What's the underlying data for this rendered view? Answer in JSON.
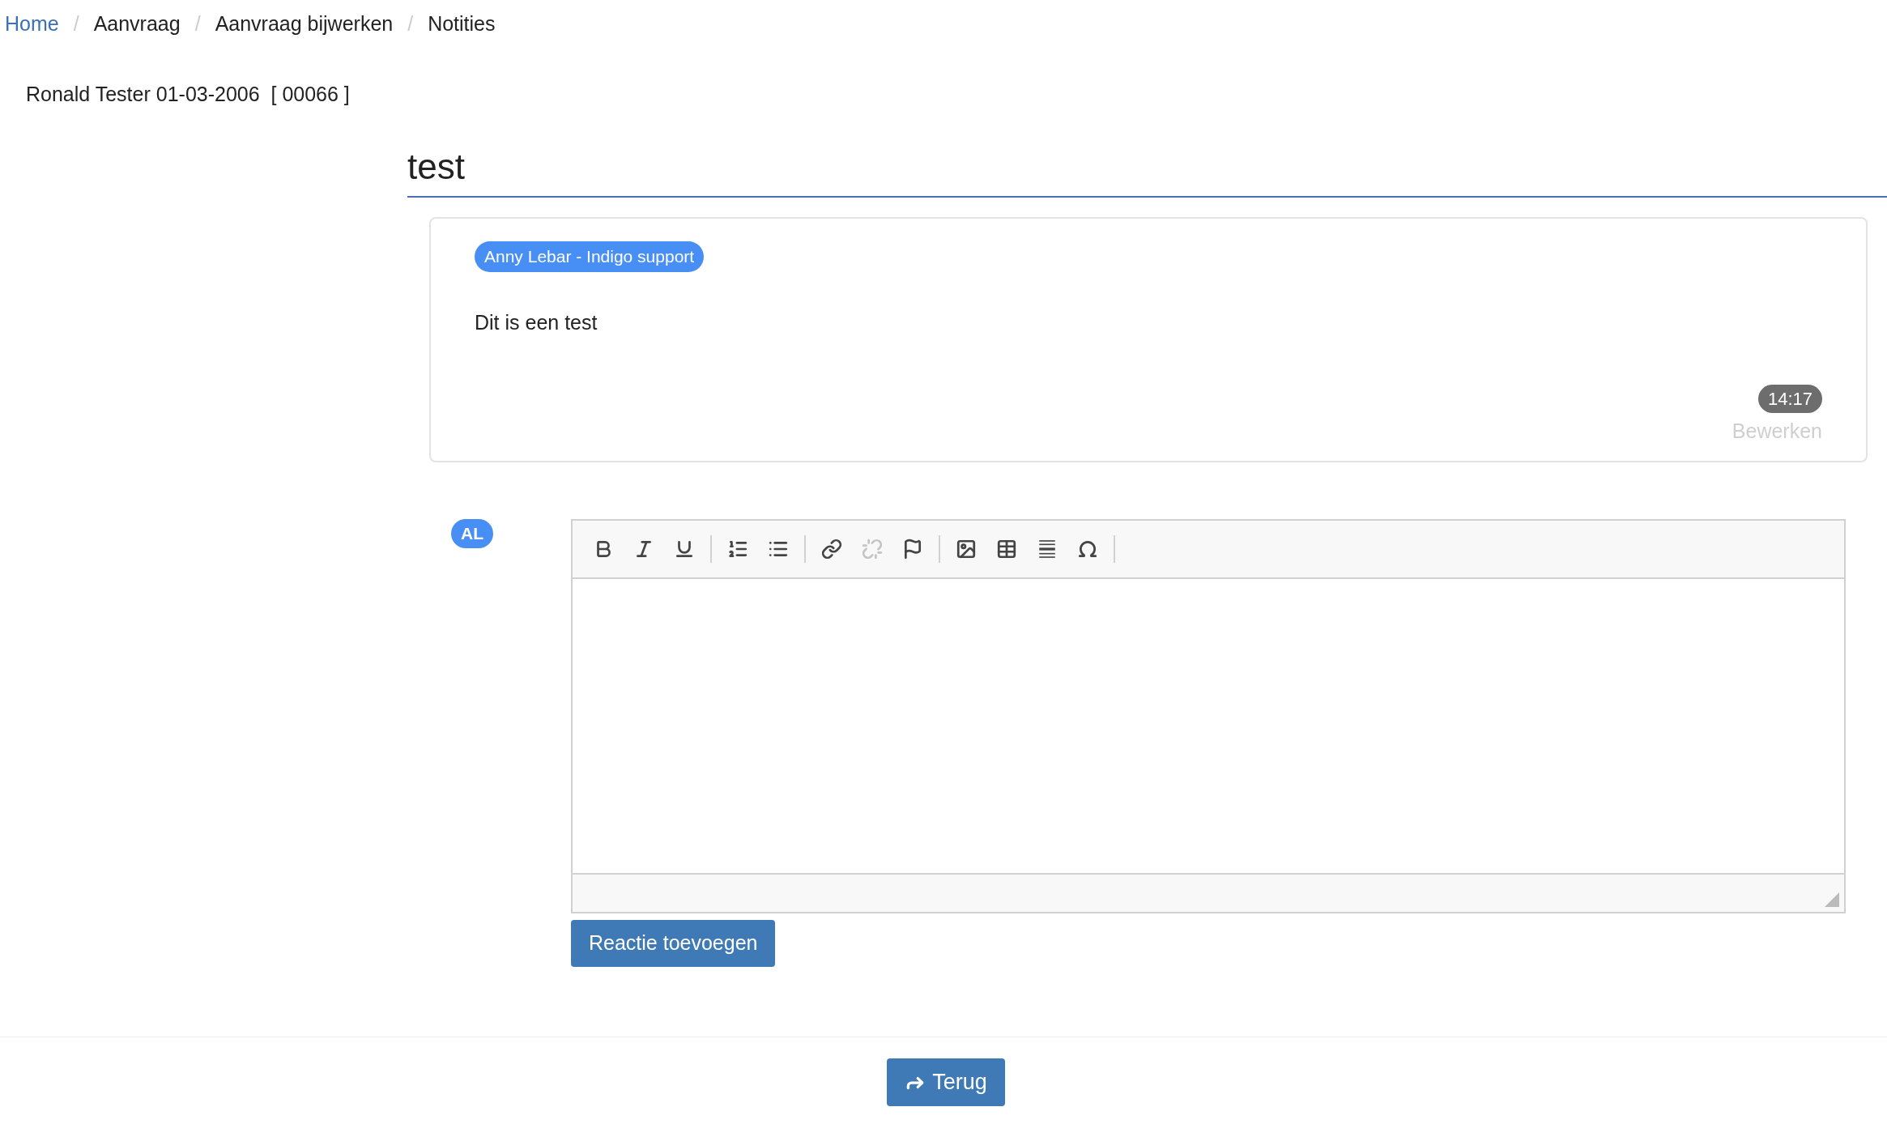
{
  "breadcrumb": [
    {
      "label": "Home",
      "link": true
    },
    {
      "separator": "/",
      "label": "Aanvraag",
      "link": false
    },
    {
      "separator": "/",
      "label": "Aanvraag bijwerken",
      "link": false
    },
    {
      "separator": "/",
      "label": "Notities",
      "link": false
    }
  ],
  "patient": "Ronald Tester 01-03-2006  [ 00066 ]",
  "title": "test",
  "note": {
    "author": "Anny Lebar - Indigo support",
    "text": "Dit is een test",
    "time": "14:17",
    "edit_link": "Bewerken"
  },
  "reply": {
    "initials": "AL",
    "toolbar": [
      {
        "kind": "bold",
        "disabled": false
      },
      {
        "kind": "italic",
        "disabled": false
      },
      {
        "kind": "underline",
        "disabled": false
      },
      {
        "kind": "separator"
      },
      {
        "kind": "numbered-list",
        "disabled": false
      },
      {
        "kind": "bulleted-list",
        "disabled": false
      },
      {
        "kind": "separator"
      },
      {
        "kind": "link",
        "disabled": false
      },
      {
        "kind": "unlink",
        "disabled": true
      },
      {
        "kind": "anchor",
        "disabled": false
      },
      {
        "kind": "separator"
      },
      {
        "kind": "image",
        "disabled": false
      },
      {
        "kind": "table",
        "disabled": false
      },
      {
        "kind": "horizontal-line",
        "disabled": false
      },
      {
        "kind": "special-char",
        "disabled": false
      },
      {
        "kind": "separator"
      }
    ],
    "submit": "Reactie toevoegen"
  },
  "back_button": "Terug"
}
